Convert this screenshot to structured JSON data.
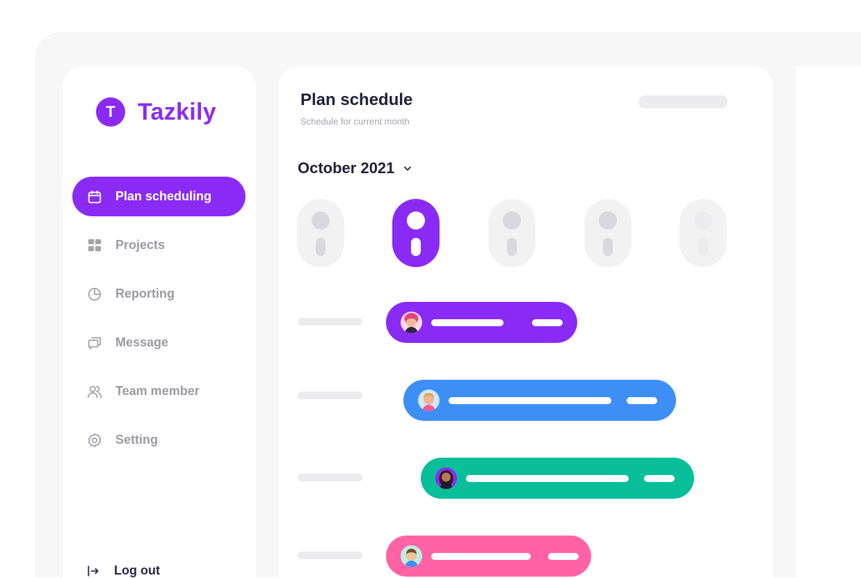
{
  "app": {
    "name": "Tazkily",
    "logo_letter": "T",
    "brand_color": "#8a2bf5"
  },
  "sidebar": {
    "items": [
      {
        "label": "Plan scheduling",
        "icon": "calendar-icon",
        "active": true
      },
      {
        "label": "Projects",
        "icon": "grid-icon",
        "active": false
      },
      {
        "label": "Reporting",
        "icon": "pie-chart-icon",
        "active": false
      },
      {
        "label": "Message",
        "icon": "chat-icon",
        "active": false
      },
      {
        "label": "Team member",
        "icon": "users-icon",
        "active": false
      },
      {
        "label": "Setting",
        "icon": "gear-icon",
        "active": false
      }
    ],
    "logout_label": "Log out",
    "logout_icon": "logout-icon"
  },
  "header": {
    "title": "Plan schedule",
    "subtitle": "Schedule for current month"
  },
  "calendar": {
    "month_label": "October 2021",
    "dropdown_icon": "chevron-down-icon",
    "selected_day_index": 1,
    "day_count": 5
  },
  "tasks": [
    {
      "color": "#8a2bf5",
      "avatar": "avatar-woman-pink-hair"
    },
    {
      "color": "#3d8ff5",
      "avatar": "avatar-man-blond"
    },
    {
      "color": "#08bf9a",
      "avatar": "avatar-woman-dark-hair"
    },
    {
      "color": "#ff63a5",
      "avatar": "avatar-boy-brown-hair"
    }
  ]
}
